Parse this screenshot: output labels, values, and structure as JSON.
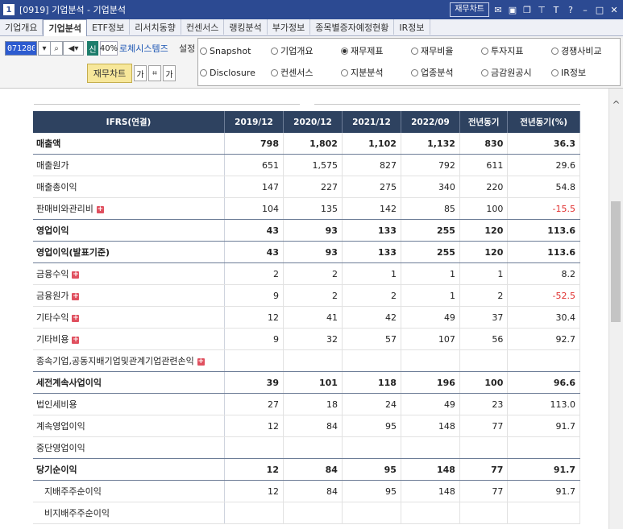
{
  "window": {
    "number": "1",
    "title": "[0919] 기업분석 - 기업분석",
    "finance_chart_button": "재무차트",
    "icons": [
      "mail-icon",
      "window-icon",
      "copy-icon",
      "pin-icon",
      "font-icon",
      "help-icon",
      "minimize-icon",
      "maximize-icon",
      "close-icon"
    ]
  },
  "tabs": [
    "기업개요",
    "기업분석",
    "ETF정보",
    "리서치동향",
    "컨센서스",
    "랭킹분석",
    "부가정보",
    "종목별증자예정현황",
    "IR정보"
  ],
  "active_tab": "기업분석",
  "controls": {
    "stock_code": "071280",
    "market_badge": "신",
    "margin_rate": "40%",
    "company_name": "로체시스템즈",
    "settings_label": "설정",
    "finance_chart_label": "재무차트",
    "small_buttons": [
      "가",
      "",
      "가"
    ]
  },
  "radio_options": [
    {
      "label": "Snapshot",
      "checked": false
    },
    {
      "label": "기업개요",
      "checked": false
    },
    {
      "label": "재무제표",
      "checked": true
    },
    {
      "label": "재무비율",
      "checked": false
    },
    {
      "label": "투자지표",
      "checked": false
    },
    {
      "label": "경쟁사비교",
      "checked": false
    },
    {
      "label": "Disclosure",
      "checked": false
    },
    {
      "label": "컨센서스",
      "checked": false
    },
    {
      "label": "지분분석",
      "checked": false
    },
    {
      "label": "업종분석",
      "checked": false
    },
    {
      "label": "금감원공시",
      "checked": false
    },
    {
      "label": "IR정보",
      "checked": false
    }
  ],
  "table": {
    "headers": [
      "IFRS(연결)",
      "2019/12",
      "2020/12",
      "2021/12",
      "2022/09",
      "전년동기",
      "전년동기(%)"
    ],
    "rows": [
      {
        "label": "매출액",
        "values": [
          "798",
          "1,802",
          "1,102",
          "1,132",
          "830",
          "36.3"
        ],
        "bold": true,
        "sep": true,
        "expand": false,
        "indent": false
      },
      {
        "label": "매출원가",
        "values": [
          "651",
          "1,575",
          "827",
          "792",
          "611",
          "29.6"
        ],
        "bold": false,
        "sep": false,
        "expand": false,
        "indent": false
      },
      {
        "label": "매출총이익",
        "values": [
          "147",
          "227",
          "275",
          "340",
          "220",
          "54.8"
        ],
        "bold": false,
        "sep": false,
        "expand": false,
        "indent": false
      },
      {
        "label": "판매비와관리비",
        "values": [
          "104",
          "135",
          "142",
          "85",
          "100",
          "-15.5"
        ],
        "bold": false,
        "sep": true,
        "expand": true,
        "indent": false
      },
      {
        "label": "영업이익",
        "values": [
          "43",
          "93",
          "133",
          "255",
          "120",
          "113.6"
        ],
        "bold": true,
        "sep": true,
        "expand": false,
        "indent": false
      },
      {
        "label": "영업이익(발표기준)",
        "values": [
          "43",
          "93",
          "133",
          "255",
          "120",
          "113.6"
        ],
        "bold": true,
        "sep": true,
        "expand": false,
        "indent": false
      },
      {
        "label": "금융수익",
        "values": [
          "2",
          "2",
          "1",
          "1",
          "1",
          "8.2"
        ],
        "bold": false,
        "sep": false,
        "expand": true,
        "indent": false
      },
      {
        "label": "금융원가",
        "values": [
          "9",
          "2",
          "2",
          "1",
          "2",
          "-52.5"
        ],
        "bold": false,
        "sep": false,
        "expand": true,
        "indent": false
      },
      {
        "label": "기타수익",
        "values": [
          "12",
          "41",
          "42",
          "49",
          "37",
          "30.4"
        ],
        "bold": false,
        "sep": false,
        "expand": true,
        "indent": false
      },
      {
        "label": "기타비용",
        "values": [
          "9",
          "32",
          "57",
          "107",
          "56",
          "92.7"
        ],
        "bold": false,
        "sep": false,
        "expand": true,
        "indent": false
      },
      {
        "label": "종속기업,공동지배기업및관계기업관련손익",
        "values": [
          "",
          "",
          "",
          "",
          "",
          ""
        ],
        "bold": false,
        "sep": true,
        "expand": true,
        "indent": false
      },
      {
        "label": "세전계속사업이익",
        "values": [
          "39",
          "101",
          "118",
          "196",
          "100",
          "96.6"
        ],
        "bold": true,
        "sep": true,
        "expand": false,
        "indent": false
      },
      {
        "label": "법인세비용",
        "values": [
          "27",
          "18",
          "24",
          "49",
          "23",
          "113.0"
        ],
        "bold": false,
        "sep": false,
        "expand": false,
        "indent": false
      },
      {
        "label": "계속영업이익",
        "values": [
          "12",
          "84",
          "95",
          "148",
          "77",
          "91.7"
        ],
        "bold": false,
        "sep": false,
        "expand": false,
        "indent": false
      },
      {
        "label": "중단영업이익",
        "values": [
          "",
          "",
          "",
          "",
          "",
          ""
        ],
        "bold": false,
        "sep": true,
        "expand": false,
        "indent": false
      },
      {
        "label": "당기순이익",
        "values": [
          "12",
          "84",
          "95",
          "148",
          "77",
          "91.7"
        ],
        "bold": true,
        "sep": true,
        "expand": false,
        "indent": false
      },
      {
        "label": "지배주주순이익",
        "values": [
          "12",
          "84",
          "95",
          "148",
          "77",
          "91.7"
        ],
        "bold": false,
        "sep": false,
        "expand": false,
        "indent": true
      },
      {
        "label": "비지배주주순이익",
        "values": [
          "",
          "",
          "",
          "",
          "",
          ""
        ],
        "bold": false,
        "sep": false,
        "expand": false,
        "indent": true
      }
    ]
  },
  "colors": {
    "titlebar": "#2c4a92",
    "header": "#2e4260",
    "negative": "#e0302f",
    "expand_icon": "#e0505f",
    "chart_button": "#f7e79a"
  }
}
